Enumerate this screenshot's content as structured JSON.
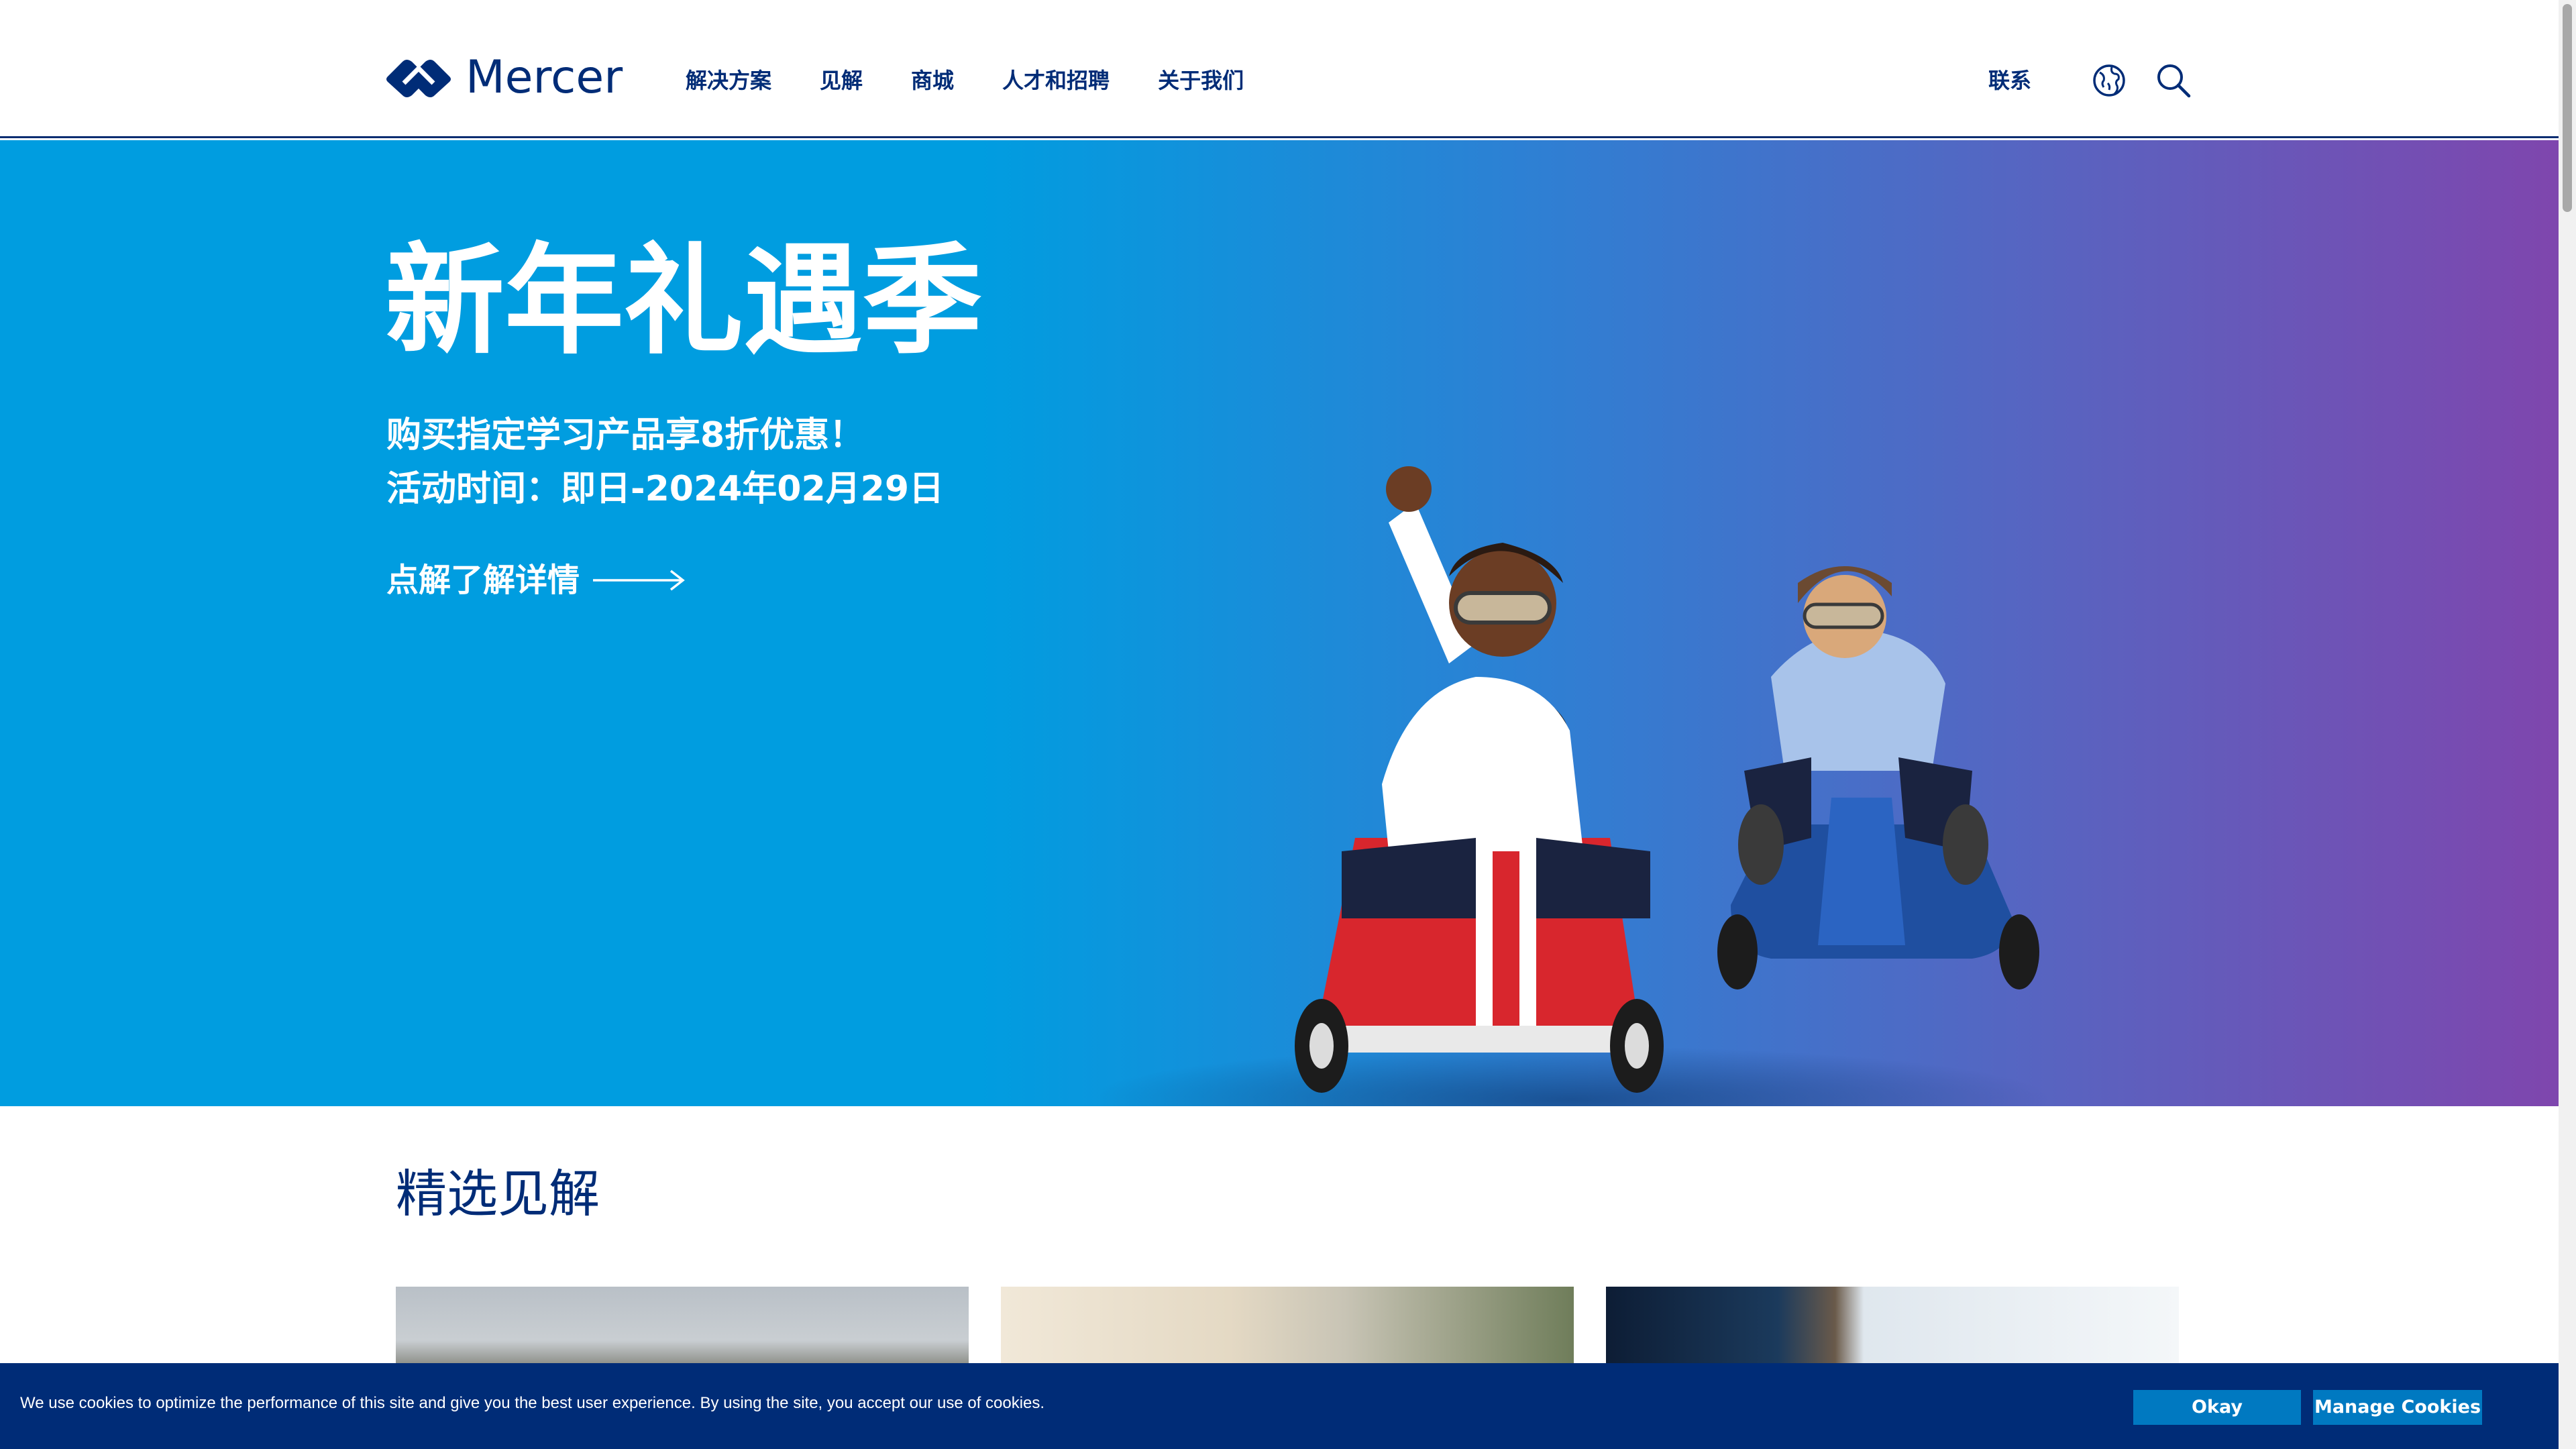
{
  "header": {
    "brand": "Mercer",
    "nav": [
      "解决方案",
      "见解",
      "商城",
      "人才和招聘",
      "关于我们"
    ],
    "contact": "联系",
    "icons": {
      "globe": "globe-icon",
      "search": "search-icon"
    },
    "brand_color": "#002c77"
  },
  "hero": {
    "title": "新年礼遇季",
    "line1": "购买指定学习产品享8折优惠！",
    "line2": "活动时间：即日-2024年02月29日",
    "cta": "点解了解详情",
    "gradient": [
      "#009de0",
      "#8045ad"
    ]
  },
  "featured": {
    "title": "精选见解"
  },
  "cookie": {
    "text": "We use cookies to optimize the performance of this site and give you the best user experience. By using the site, you accept our use of cookies.",
    "okay": "Okay",
    "manage": "Manage Cookies"
  }
}
